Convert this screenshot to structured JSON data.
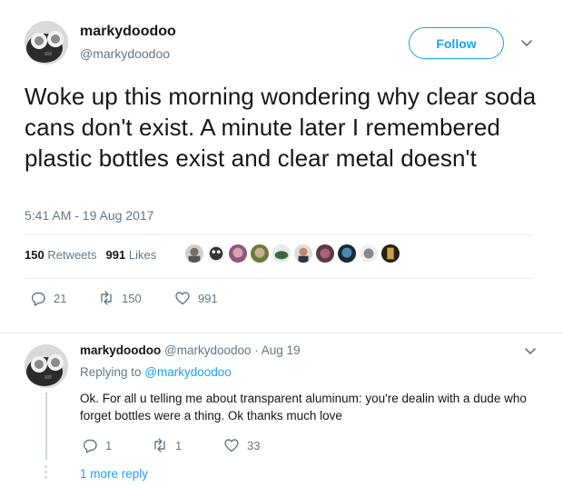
{
  "main_tweet": {
    "display_name": "markydoodoo",
    "handle": "@markydoodoo",
    "follow_label": "Follow",
    "text": "Woke up this morning wondering why clear soda cans don't exist. A minute later I remembered plastic bottles exist and clear metal doesn't",
    "timestamp": "5:41 AM - 19 Aug 2017",
    "retweets_count": "150",
    "retweets_label": "Retweets",
    "likes_count": "991",
    "likes_label": "Likes",
    "actions": {
      "reply_count": "21",
      "retweet_count": "150",
      "like_count": "991"
    }
  },
  "reply_tweet": {
    "display_name": "markydoodoo",
    "handle_date": "@markydoodoo · Aug 19",
    "replying_prefix": "Replying to",
    "replying_to": "@markydoodoo",
    "text": "Ok. For all u telling me about transparent aluminum: you're dealin with a dude who forget bottles were a thing. Ok thanks much love",
    "actions": {
      "reply_count": "1",
      "retweet_count": "1",
      "like_count": "33"
    },
    "more_replies_label": "1 more reply"
  },
  "colors": {
    "accent": "#1da1f2",
    "secondary_text": "#657786",
    "divider": "#e6ecf0"
  },
  "icons": [
    "chevron-down-icon",
    "reply-icon",
    "retweet-icon",
    "heart-icon"
  ]
}
